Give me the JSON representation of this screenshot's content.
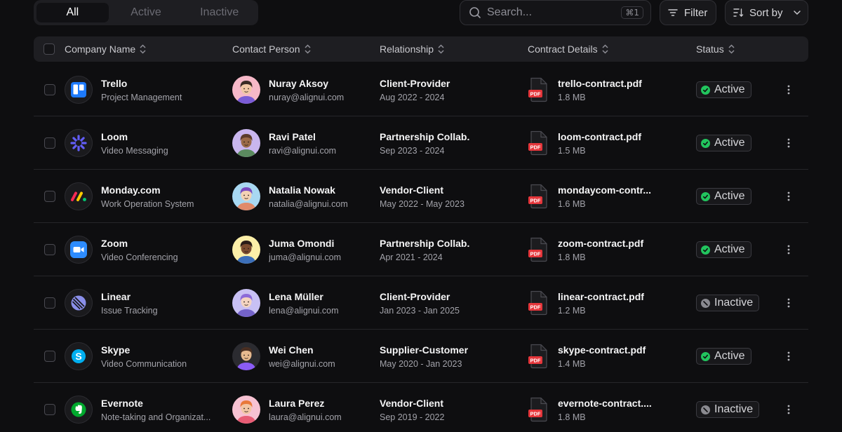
{
  "tabs": [
    {
      "label": "All",
      "active": true
    },
    {
      "label": "Active",
      "active": false
    },
    {
      "label": "Inactive",
      "active": false
    }
  ],
  "search": {
    "placeholder": "Search...",
    "value": "",
    "shortcut": "⌘1"
  },
  "filter_label": "Filter",
  "sort_label": "Sort by",
  "columns": {
    "company": "Company Name",
    "contact": "Contact Person",
    "relationship": "Relationship",
    "contract": "Contract Details",
    "status": "Status"
  },
  "colors": {
    "active_dot": "#22c55e",
    "inactive_dot": "#8a8a90",
    "pdf_red": "#e5363b"
  },
  "rows": [
    {
      "company": "Trello",
      "description": "Project Management",
      "logo_icon": "trello-logo-icon",
      "contact_name": "Nuray Aksoy",
      "contact_email": "nuray@alignui.com",
      "relationship": "Client-Provider",
      "period": "Aug 2022 - 2024",
      "file_name": "trello-contract.pdf",
      "file_size": "1.8 MB",
      "status": "Active"
    },
    {
      "company": "Loom",
      "description": "Video Messaging",
      "logo_icon": "loom-logo-icon",
      "contact_name": "Ravi Patel",
      "contact_email": "ravi@alignui.com",
      "relationship": "Partnership Collab.",
      "period": "Sep 2023 - 2024",
      "file_name": "loom-contract.pdf",
      "file_size": "1.5 MB",
      "status": "Active"
    },
    {
      "company": "Monday.com",
      "description": "Work Operation System",
      "logo_icon": "monday-logo-icon",
      "contact_name": "Natalia Nowak",
      "contact_email": "natalia@alignui.com",
      "relationship": "Vendor-Client",
      "period": "May 2022 - May 2023",
      "file_name": "mondaycom-contr...",
      "file_size": "1.6 MB",
      "status": "Active"
    },
    {
      "company": "Zoom",
      "description": "Video Conferencing",
      "logo_icon": "zoom-logo-icon",
      "contact_name": "Juma Omondi",
      "contact_email": "juma@alignui.com",
      "relationship": "Partnership Collab.",
      "period": "Apr 2021 - 2024",
      "file_name": "zoom-contract.pdf",
      "file_size": "1.8 MB",
      "status": "Active"
    },
    {
      "company": "Linear",
      "description": "Issue Tracking",
      "logo_icon": "linear-logo-icon",
      "contact_name": "Lena Müller",
      "contact_email": "lena@alignui.com",
      "relationship": "Client-Provider",
      "period": "Jan 2023 - Jan 2025",
      "file_name": "linear-contract.pdf",
      "file_size": "1.2 MB",
      "status": "Inactive"
    },
    {
      "company": "Skype",
      "description": "Video Communication",
      "logo_icon": "skype-logo-icon",
      "contact_name": "Wei Chen",
      "contact_email": "wei@alignui.com",
      "relationship": "Supplier-Customer",
      "period": "May 2020 - Jan 2023",
      "file_name": "skype-contract.pdf",
      "file_size": "1.4 MB",
      "status": "Active"
    },
    {
      "company": "Evernote",
      "description": "Note-taking and Organizat...",
      "logo_icon": "evernote-logo-icon",
      "contact_name": "Laura Perez",
      "contact_email": "laura@alignui.com",
      "relationship": "Vendor-Client",
      "period": "Sep 2019 - 2022",
      "file_name": "evernote-contract....",
      "file_size": "1.8 MB",
      "status": "Inactive"
    }
  ]
}
